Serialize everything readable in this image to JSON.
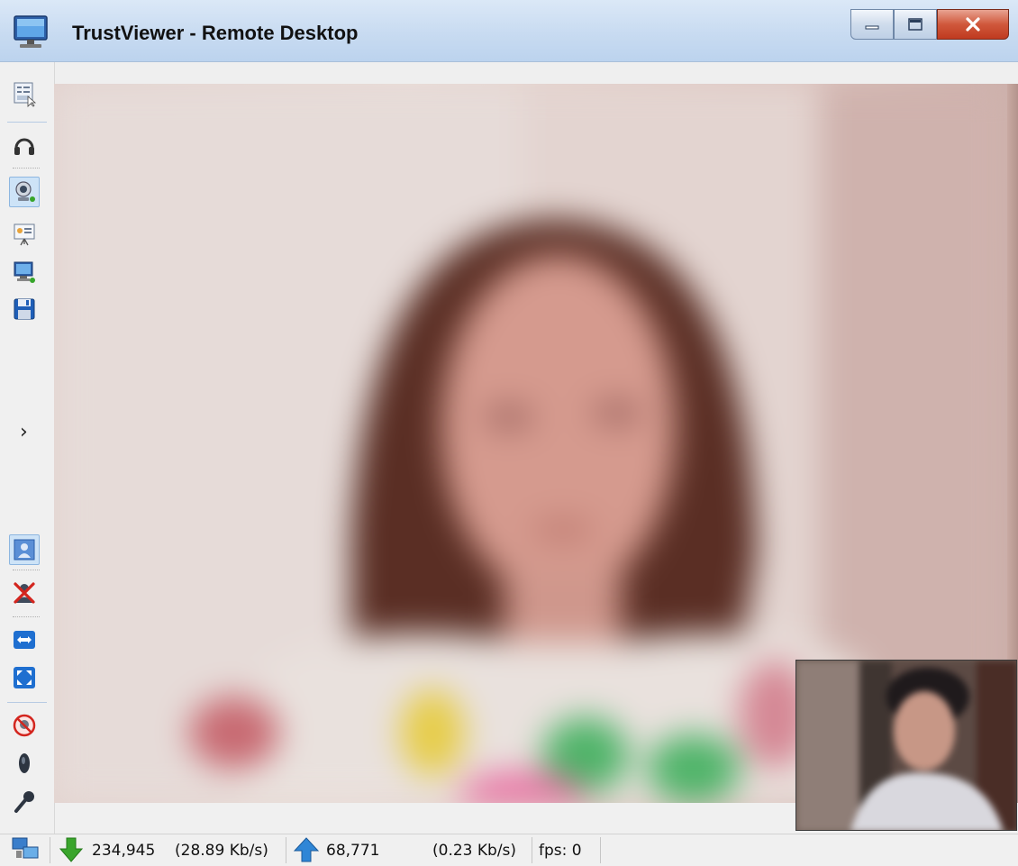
{
  "window": {
    "title": "TrustViewer - Remote Desktop",
    "app_icon": "monitor-icon",
    "controls": [
      "minimize-icon",
      "maximize-icon",
      "close-icon"
    ]
  },
  "toolbar": {
    "items": [
      {
        "name": "session-settings-icon"
      },
      {
        "name": "headset-icon"
      },
      {
        "name": "webcam-icon",
        "active": true
      },
      {
        "name": "presentation-icon"
      },
      {
        "name": "remote-computer-icon"
      },
      {
        "name": "save-icon"
      },
      {
        "name": "expand-panel-icon",
        "glyph": "›"
      },
      {
        "name": "video-view-icon",
        "active": true
      },
      {
        "name": "disconnect-user-icon"
      },
      {
        "name": "fit-width-icon"
      },
      {
        "name": "fullscreen-icon"
      },
      {
        "name": "mute-webcam-icon"
      },
      {
        "name": "speaker-icon"
      },
      {
        "name": "microphone-icon"
      }
    ]
  },
  "statusbar": {
    "received_bytes": "234,945",
    "received_rate": "(28.89 Kb/s)",
    "sent_bytes": "68,771",
    "sent_rate": "(0.23 Kb/s)",
    "fps": "fps: 0"
  },
  "colors": {
    "titlebar": "#c8dbf1",
    "toolbar": "#f0f0f0",
    "close_button": "#d0583c",
    "download_arrow": "#3aa52c",
    "upload_arrow": "#2f86d6"
  }
}
